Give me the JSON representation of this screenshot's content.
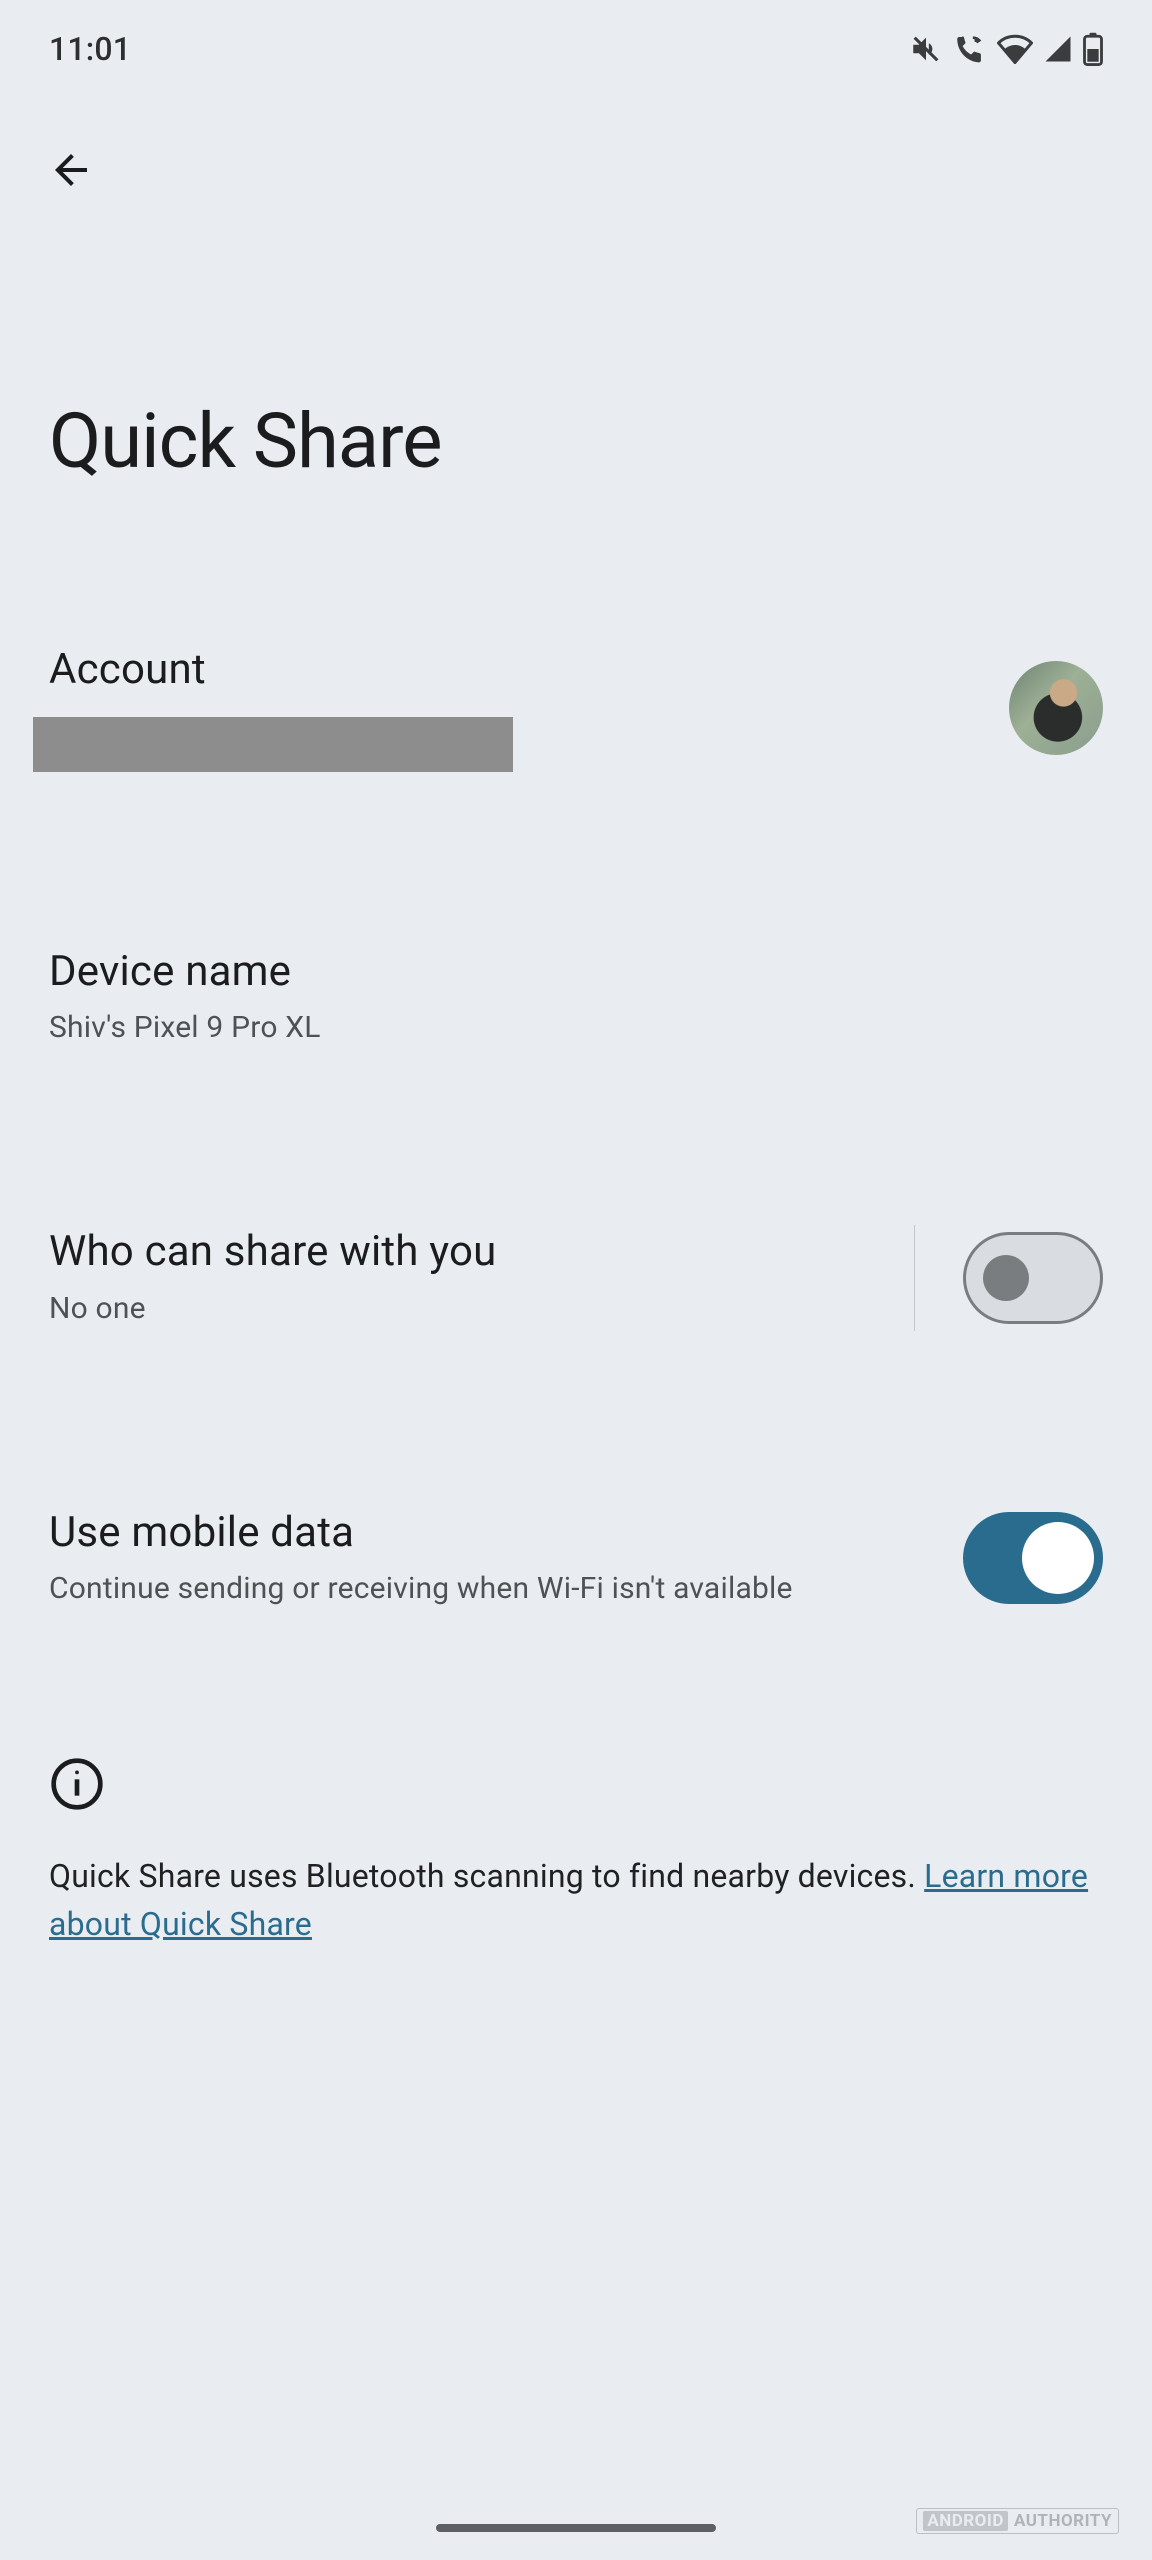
{
  "status": {
    "time": "11:01"
  },
  "page": {
    "title": "Quick Share"
  },
  "account": {
    "label": "Account"
  },
  "device_name": {
    "label": "Device name",
    "value": "Shiv's Pixel 9 Pro XL"
  },
  "who_can_share": {
    "label": "Who can share with you",
    "value": "No one",
    "enabled": false
  },
  "mobile_data": {
    "label": "Use mobile data",
    "description": "Continue sending or receiving when Wi-Fi isn't available",
    "enabled": true
  },
  "info": {
    "text": "Quick Share uses Bluetooth scanning to find nearby devices. ",
    "link_text": "Learn more about Quick Share"
  },
  "watermark": {
    "left": "ANDROID",
    "right": "AUTHORITY"
  }
}
